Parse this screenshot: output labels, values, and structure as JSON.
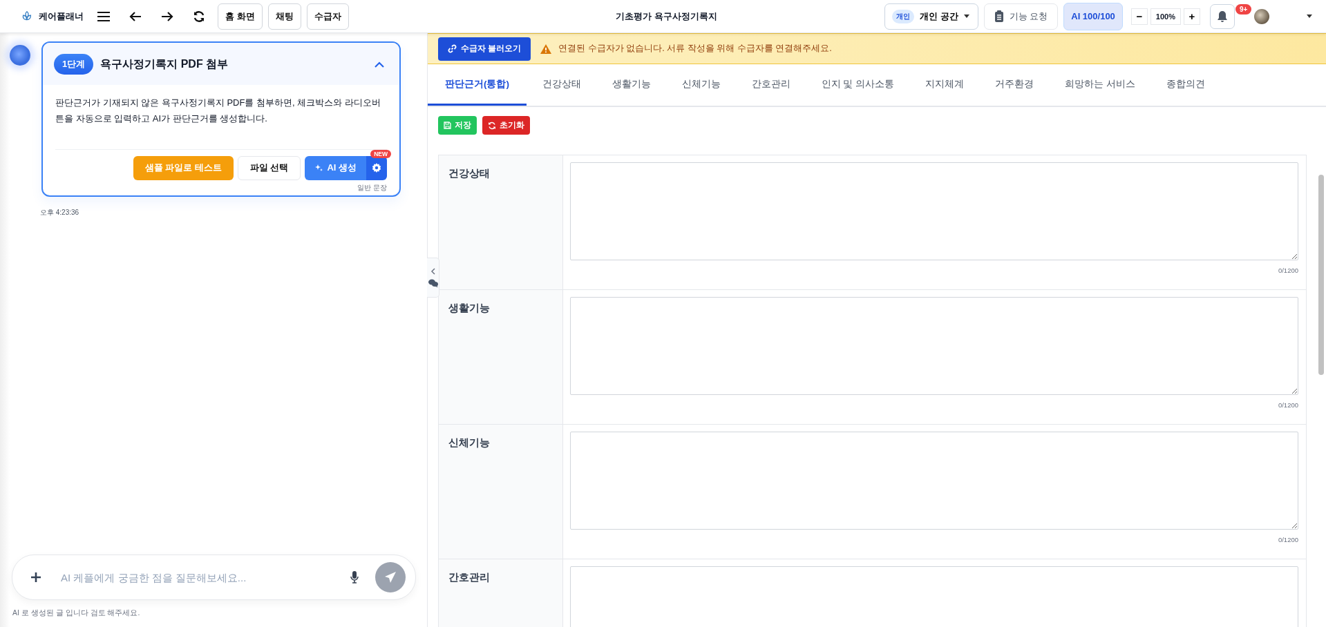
{
  "topbar": {
    "app_name": "케어플래너",
    "nav_buttons": [
      "홈 화면",
      "채팅",
      "수급자"
    ],
    "title": "기초평가 욕구사정기록지",
    "workspace": {
      "badge": "개인",
      "label": "개인 공간"
    },
    "feature_request": "기능 요청",
    "ai_quota": "AI 100/100",
    "zoom": {
      "minus": "−",
      "value": "100%",
      "plus": "+"
    },
    "notification_badge": "9+"
  },
  "chat": {
    "card": {
      "step": "1단계",
      "title": "욕구사정기록지 PDF 첨부",
      "expanded": true,
      "description": "판단근거가 기재되지 않은 욕구사정기록지 PDF를 첨부하면, 체크박스와 라디오버튼을 자동으로 입력하고 AI가 판단근거를 생성합니다.",
      "sample_button": "샘플 파일로 테스트",
      "file_button": "파일 선택",
      "ai_button": "AI 생성",
      "new_badge": "NEW",
      "mode_caption": "일반 문장"
    },
    "time": "오후 4:23:36",
    "input": {
      "placeholder": "AI 케플에게 궁금한 점을 질문해보세요..."
    },
    "disclaimer": "AI 로 생성된 글 입니다 검토 해주세요."
  },
  "form": {
    "load_button": "수급자 불러오기",
    "warning": "연결된 수급자가 없습니다. 서류 작성을 위해 수급자를 연결해주세요.",
    "tabs": [
      {
        "label": "판단근거(통합)",
        "selected": true
      },
      {
        "label": "건강상태",
        "selected": false
      },
      {
        "label": "생활기능",
        "selected": false
      },
      {
        "label": "신체기능",
        "selected": false
      },
      {
        "label": "간호관리",
        "selected": false
      },
      {
        "label": "인지 및 의사소통",
        "selected": false
      },
      {
        "label": "지지체계",
        "selected": false
      },
      {
        "label": "거주환경",
        "selected": false
      },
      {
        "label": "희망하는 서비스",
        "selected": false
      },
      {
        "label": "종합의견",
        "selected": false
      }
    ],
    "save_button": "저장",
    "reset_button": "초기화",
    "sections": [
      {
        "label": "건강상태",
        "counter": "0/1200"
      },
      {
        "label": "생활기능",
        "counter": "0/1200"
      },
      {
        "label": "신체기능",
        "counter": "0/1200"
      },
      {
        "label": "간호관리"
      }
    ]
  }
}
